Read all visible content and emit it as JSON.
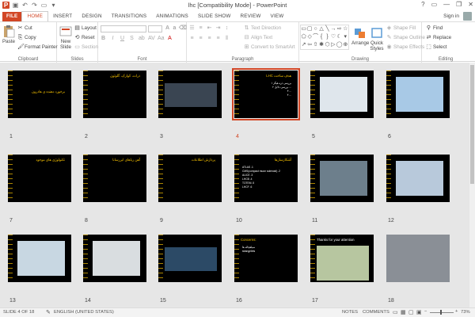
{
  "window": {
    "title": "lhc [Compatibility Mode] - PowerPoint",
    "signin": "Sign in",
    "controls": [
      "?",
      "▭",
      "—",
      "❐",
      "✕"
    ]
  },
  "tabs": [
    "FILE",
    "HOME",
    "INSERT",
    "DESIGN",
    "TRANSITIONS",
    "ANIMATIONS",
    "SLIDE SHOW",
    "REVIEW",
    "VIEW"
  ],
  "ribbon": {
    "clipboard": {
      "paste": "Paste",
      "cut": "Cut",
      "copy": "Copy",
      "format_painter": "Format Painter",
      "label": "Clipboard"
    },
    "slides": {
      "new_slide": "New Slide",
      "layout": "Layout",
      "reset": "Reset",
      "section": "Section",
      "label": "Slides"
    },
    "font": {
      "label": "Font"
    },
    "paragraph": {
      "text_direction": "Text Direction",
      "align_text": "Align Text",
      "convert_smartart": "Convert to SmartArt",
      "label": "Paragraph"
    },
    "drawing": {
      "arrange": "Arrange",
      "quick_styles": "Quick Styles",
      "shape_fill": "Shape Fill",
      "shape_outline": "Shape Outline",
      "shape_effects": "Shape Effects",
      "label": "Drawing"
    },
    "editing": {
      "find": "Find",
      "replace": "Replace",
      "select": "Select",
      "label": "Editing"
    }
  },
  "slides": [
    {
      "num": "1",
      "title": "برخورد دهنده ی هادرون",
      "lines": [
        "",
        ""
      ]
    },
    {
      "num": "2",
      "title": "ذرات، کوارک، گلوئون",
      "lines": []
    },
    {
      "num": "3",
      "title": "",
      "lines": []
    },
    {
      "num": "4",
      "title": "LHC هدف ساخت",
      "lines": [
        "۱ بررسی ذره هیگز",
        "۲ بررسی دلایل ...",
        "۳ ...",
        "۴ ..."
      ]
    },
    {
      "num": "5",
      "title": "",
      "lines": []
    },
    {
      "num": "6",
      "title": "",
      "lines": []
    },
    {
      "num": "7",
      "title": "تکنولوژی های موجود",
      "lines": [
        "",
        "",
        ""
      ]
    },
    {
      "num": "8",
      "title": "آهن رباهای ابررسانا",
      "lines": [
        "",
        "",
        ""
      ]
    },
    {
      "num": "9",
      "title": "پردازش اطلاعات",
      "lines": [
        "",
        "",
        ""
      ]
    },
    {
      "num": "10",
      "title": "آشکارسازها",
      "lines": [
        "ATLAS .1",
        "CMS(compact muon solenoid) .2",
        "ALICE .3",
        "LHCB .4",
        "TOTEM .5",
        "LHCF .6"
      ]
    },
    {
      "num": "11",
      "title": "",
      "lines": []
    },
    {
      "num": "12",
      "title": "",
      "lines": []
    },
    {
      "num": "13",
      "title": "",
      "lines": []
    },
    {
      "num": "14",
      "title": "",
      "lines": []
    },
    {
      "num": "15",
      "title": "",
      "lines": []
    },
    {
      "num": "16",
      "title": "Concerns:",
      "lines": [
        "سیاهچاله ها",
        "strangelets"
      ]
    },
    {
      "num": "17",
      "title": "Thanks for your attention",
      "lines": []
    },
    {
      "num": "18",
      "title": "",
      "lines": []
    }
  ],
  "selected_slide": "4",
  "status": {
    "slide_info": "SLIDE 4 OF 18",
    "language": "ENGLISH (UNITED STATES)",
    "notes": "NOTES",
    "comments": "COMMENTS",
    "zoom": "73%"
  },
  "colors": {
    "accent": "#d24726",
    "slide_title": "#f5c000"
  }
}
